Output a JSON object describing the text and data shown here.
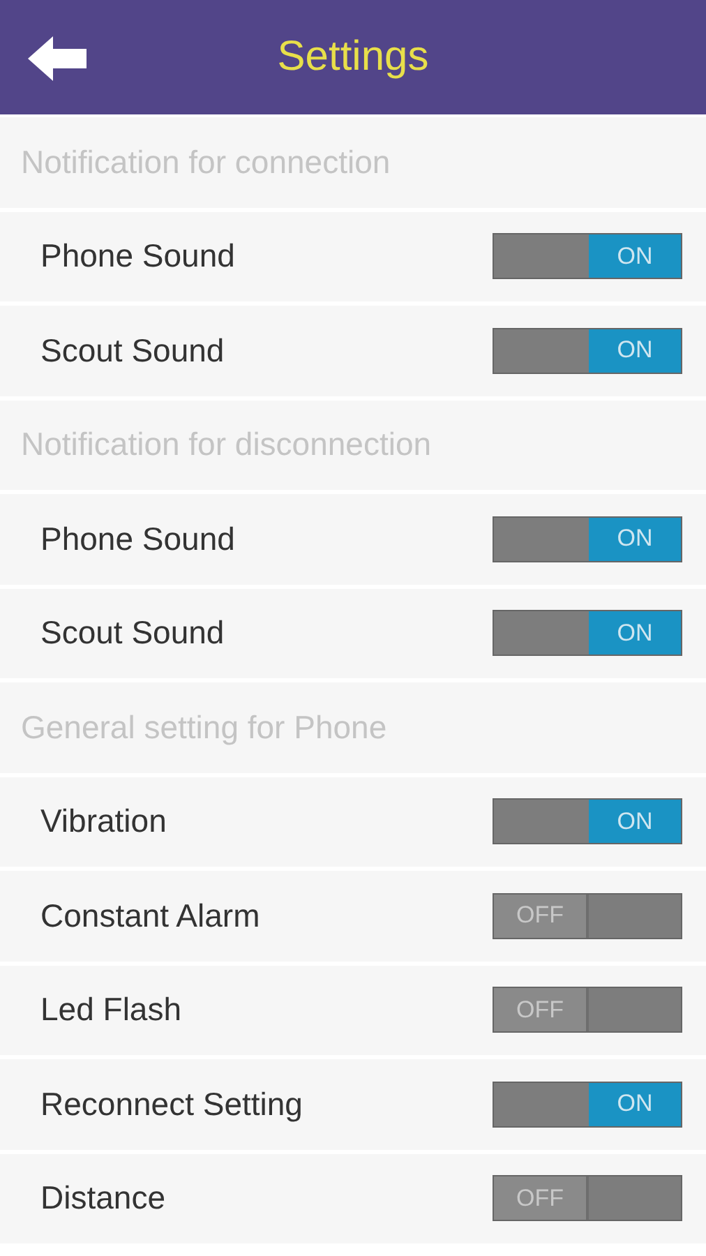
{
  "header": {
    "title": "Settings"
  },
  "sections": [
    {
      "title": "Notification for connection",
      "items": [
        {
          "label": "Phone Sound",
          "on": true,
          "toggle_text": "ON"
        },
        {
          "label": "Scout Sound",
          "on": true,
          "toggle_text": "ON"
        }
      ]
    },
    {
      "title": "Notification for disconnection",
      "items": [
        {
          "label": "Phone Sound",
          "on": true,
          "toggle_text": "ON"
        },
        {
          "label": "Scout Sound",
          "on": true,
          "toggle_text": "ON"
        }
      ]
    },
    {
      "title": "General setting for Phone",
      "items": [
        {
          "label": "Vibration",
          "on": true,
          "toggle_text": "ON"
        },
        {
          "label": "Constant Alarm",
          "on": false,
          "toggle_text": "OFF"
        },
        {
          "label": "Led Flash",
          "on": false,
          "toggle_text": "OFF"
        },
        {
          "label": "Reconnect Setting",
          "on": true,
          "toggle_text": "ON"
        },
        {
          "label": "Distance",
          "on": false,
          "toggle_text": "OFF"
        }
      ]
    }
  ]
}
